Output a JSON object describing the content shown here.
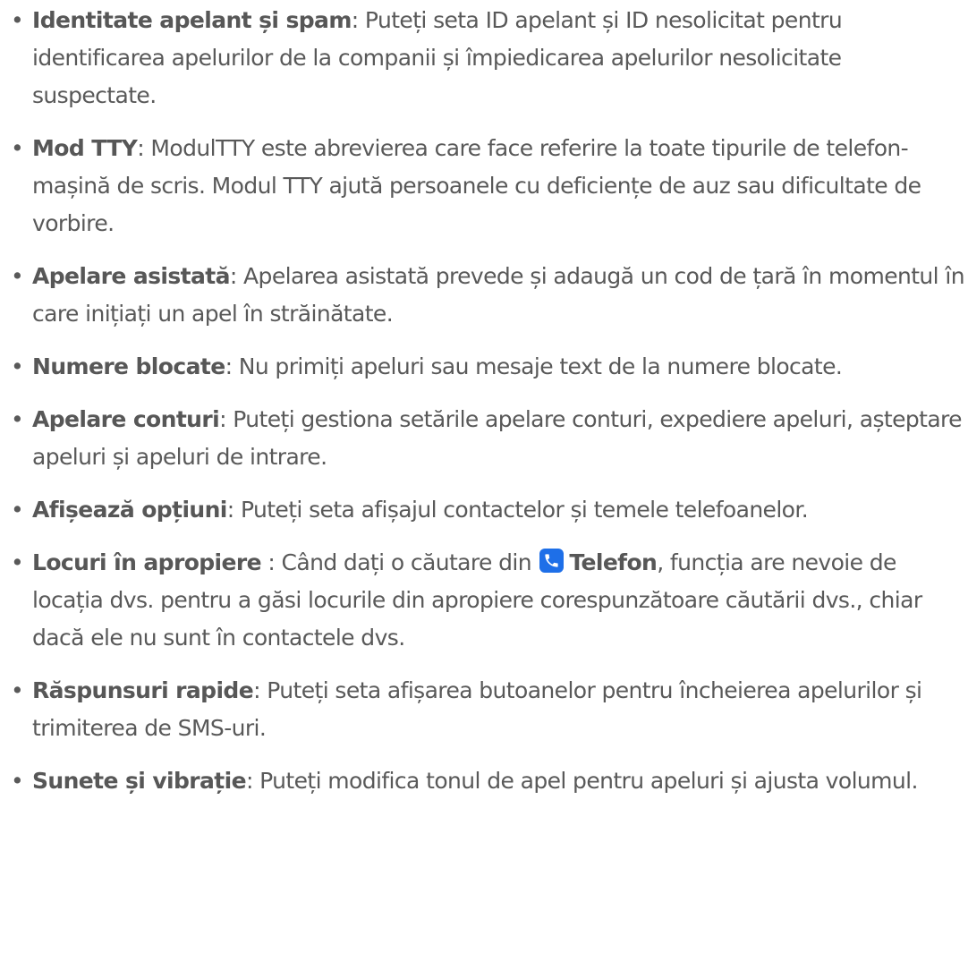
{
  "items": [
    {
      "title": "Identitate apelant și spam",
      "text": ": Puteți seta ID apelant și ID nesolicitat pentru identificarea apelurilor de la companii și împiedicarea apelurilor nesolicita­te suspectate."
    },
    {
      "title": "Mod TTY",
      "text": ": ModulTTY este abrevierea care face referire la toate tipurile de telefon-mașină de scris. Modul TTY ajută persoanele cu deficiențe de auz sau dificultate de vorbire."
    },
    {
      "title": "Apelare asistată",
      "text": ": Apelarea asistată prevede și adaugă un cod de țară în momentul în care inițiați un apel în străinătate."
    },
    {
      "title": "Numere blocate",
      "text": ": Nu primiți apeluri sau mesaje text de la numere blocate."
    },
    {
      "title": "Apelare conturi",
      "text": ": Puteți gestiona setările apelare conturi, expediere apelu­ri, așteptare apeluri și apeluri de intrare."
    },
    {
      "title": "Afișează opțiuni",
      "text": ": Puteți seta afișajul contactelor și temele telefoanelor."
    },
    {
      "title": "Locuri în apropiere",
      "text_before": " : Când dați o căutare din ",
      "app_name": "Telefon",
      "icon": "phone-app-icon",
      "text_after": ", funcția are ne­voie de locația dvs. pentru a găsi locurile din apropiere corespunzătoare căutării dvs., chiar dacă ele nu sunt în contactele dvs."
    },
    {
      "title": "Răspunsuri rapide",
      "text": ": Puteți seta afișarea butoanelor pentru încheierea ape­lurilor și trimiterea de SMS-uri."
    },
    {
      "title": "Sunete și vibrație",
      "text": ": Puteți modifica tonul de apel pentru apeluri și ajusta volumul."
    }
  ],
  "bullet": "•",
  "colors": {
    "text": "#595959",
    "icon_bg": "#1e6fe8",
    "icon_fg": "#ffffff"
  }
}
